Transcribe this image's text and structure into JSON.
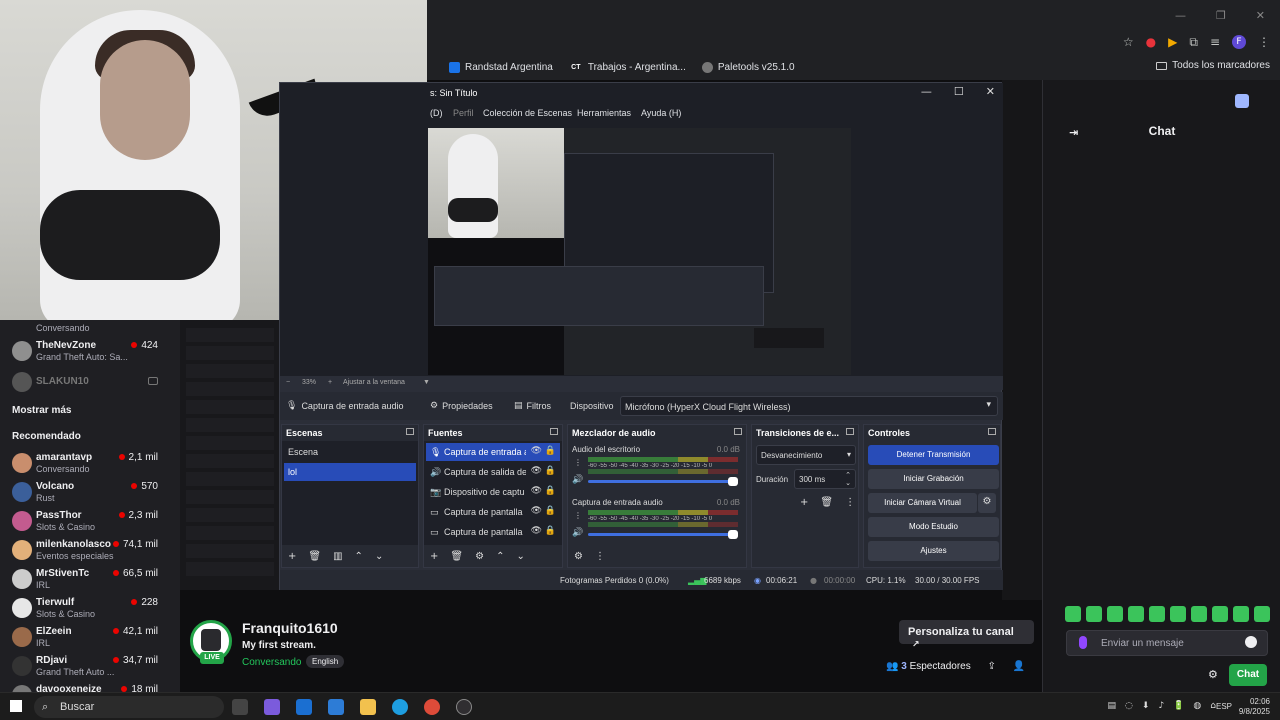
{
  "browser": {
    "window_controls": [
      "—",
      "❐",
      "✕"
    ],
    "toolbar_icons": [
      "☆",
      "●",
      "▶",
      "⧉",
      "≡",
      "F",
      "⋮"
    ],
    "bookmarks": [
      {
        "label": "Randstad Argentina",
        "icon": "randstad-icon",
        "color": "#1a73e8"
      },
      {
        "label": "Trabajos - Argentina...",
        "icon": "ct-icon",
        "color": "#555555",
        "badge": "CT"
      },
      {
        "label": "Paletools v25.1.0",
        "icon": "globe-icon",
        "color": "#777777"
      }
    ],
    "all_bookmarks": "Todos los marcadores"
  },
  "obs": {
    "title": "s: Sin Título",
    "window_controls": [
      "—",
      "☐",
      "✕"
    ],
    "menu": [
      "(D)",
      "Perfil",
      "Colección de Escenas",
      "Herramientas",
      "Ayuda (H)"
    ],
    "zoom": {
      "minus": "−",
      "value": "33%",
      "plus": "+",
      "fit": "Ajustar a la ventana",
      "arrow": "▼"
    },
    "source_toolbar": {
      "active_source": "Captura de entrada audio",
      "properties": "Propiedades",
      "filters": "Filtros",
      "device_label": "Dispositivo",
      "device_value": "Micrófono (HyperX Cloud Flight Wireless)"
    },
    "scenes": {
      "title": "Escenas",
      "items": [
        {
          "label": "Escena",
          "selected": false
        },
        {
          "label": "lol",
          "selected": true
        }
      ]
    },
    "sources": {
      "title": "Fuentes",
      "items": [
        {
          "label": "Captura de entrada a",
          "icon": "🎙",
          "selected": true
        },
        {
          "label": "Captura de salida de",
          "icon": "🔊",
          "selected": false
        },
        {
          "label": "Dispositivo de captu",
          "icon": "📷",
          "selected": false
        },
        {
          "label": "Captura de pantalla",
          "icon": "▭",
          "selected": false
        },
        {
          "label": "Captura de pantalla",
          "icon": "▭",
          "selected": false
        }
      ]
    },
    "mixer": {
      "title": "Mezclador de audio",
      "ticks": "-60 -55 -50 -45 -40 -35 -30 -25 -20 -15 -10 -5 0",
      "channels": [
        {
          "name": "Audio del escritorio",
          "db": "0.0 dB",
          "level": 1.0
        },
        {
          "name": "Captura de entrada audio",
          "db": "0.0 dB",
          "level": 1.0
        }
      ]
    },
    "transitions": {
      "title": "Transiciones de e...",
      "type": "Desvanecimiento",
      "duration_label": "Duración",
      "duration_value": "300 ms"
    },
    "controls": {
      "title": "Controles",
      "stop_stream": "Detener Transmisión",
      "start_recording": "Iniciar Grabación",
      "virtual_cam": "Iniciar Cámara Virtual",
      "studio_mode": "Modo Estudio",
      "settings": "Ajustes"
    },
    "status": {
      "dropped": "Fotogramas Perdidos 0 (0.0%)",
      "bitrate": "6689 kbps",
      "live_time": "00:06:21",
      "rec_time": "00:00:00",
      "cpu": "CPU: 1.1%",
      "fps": "30.00 / 30.00 FPS"
    }
  },
  "twitch": {
    "sidebar": {
      "top_item_game": "Conversando",
      "channels": [
        {
          "name": "TheNevZone",
          "game": "Grand Theft Auto: Sa...",
          "viewers": "424",
          "color": "#8f8f8f"
        },
        {
          "name": "SLAKUN10",
          "game": "",
          "viewers": "",
          "color": "#555555",
          "offline": true
        }
      ],
      "show_more": "Mostrar más",
      "recommended_label": "Recomendado",
      "recommended": [
        {
          "name": "amarantavp",
          "game": "Conversando",
          "viewers": "2,1 mil",
          "color": "#c98e6d"
        },
        {
          "name": "Volcano",
          "game": "Rust",
          "viewers": "570",
          "color": "#3b5f9a"
        },
        {
          "name": "PassThor",
          "game": "Slots & Casino",
          "viewers": "2,3 mil",
          "color": "#c35b8f"
        },
        {
          "name": "milenkanolasco",
          "game": "Eventos especiales",
          "viewers": "74,1 mil",
          "color": "#e2b07a"
        },
        {
          "name": "MrStivenTc",
          "game": "IRL",
          "viewers": "66,5 mil",
          "color": "#cccccc"
        },
        {
          "name": "Tierwulf",
          "game": "Slots & Casino",
          "viewers": "228",
          "color": "#e7e7e7"
        },
        {
          "name": "ElZeein",
          "game": "IRL",
          "viewers": "42,1 mil",
          "color": "#9a6a4a"
        },
        {
          "name": "RDjavi",
          "game": "Grand Theft Auto ...",
          "viewers": "34,7 mil",
          "color": "#333333"
        },
        {
          "name": "davooxeneize",
          "game": "",
          "viewers": "18 mil",
          "color": "#777777"
        }
      ]
    },
    "chat": {
      "title": "Chat",
      "input_placeholder": "Enviar un mensaje",
      "send_label": "Chat"
    },
    "stream": {
      "channel_name": "Franquito1610",
      "live_badge": "LIVE",
      "title": "My first stream.",
      "category": "Conversando",
      "tag": "English",
      "customize": "Personaliza tu canal",
      "viewer_count": "3",
      "viewer_label": "Espectadores"
    }
  },
  "taskbar": {
    "search_placeholder": "Buscar",
    "apps": [
      {
        "name": "task-view",
        "color": "#444444"
      },
      {
        "name": "copilot",
        "color": "#7b5bdc"
      },
      {
        "name": "outlook",
        "color": "#1b6fd1"
      },
      {
        "name": "store",
        "color": "#2d7cd6"
      },
      {
        "name": "file-explorer",
        "color": "#f2c14e"
      },
      {
        "name": "edge",
        "color": "#1e9ee0"
      },
      {
        "name": "chrome",
        "color": "#dd4b39"
      },
      {
        "name": "obs",
        "color": "#302e31"
      }
    ],
    "language": "ESP",
    "time": "02:06",
    "date": "9/8/2025"
  }
}
